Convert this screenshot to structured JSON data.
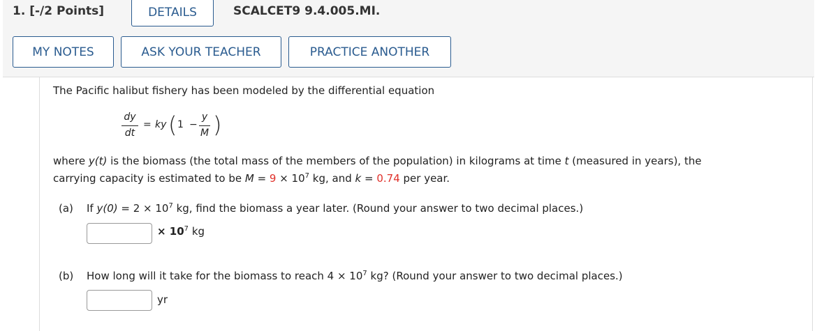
{
  "header": {
    "question_number": "1. [-/2 Points]",
    "details_tab": "DETAILS",
    "question_code": "SCALCET9 9.4.005.MI."
  },
  "toolbar": {
    "my_notes": "MY NOTES",
    "ask_teacher": "ASK YOUR TEACHER",
    "practice_another": "PRACTICE ANOTHER"
  },
  "problem": {
    "intro": "The Pacific halibut fishery has been modeled by the differential equation",
    "equation": {
      "dy": "dy",
      "dt": "dt",
      "equals": "=",
      "ky": "ky",
      "one": "1",
      "minus": "−",
      "y": "y",
      "M": "M"
    },
    "line1_a": "where ",
    "line1_b": "y(t)",
    "line1_c": " is the biomass (the total mass of the members of the population) in kilograms at time ",
    "line1_d": "t",
    "line1_e": " (measured in years), the",
    "line2_a": "carrying capacity is estimated to be ",
    "line2_M": "M",
    "line2_b": " = ",
    "line2_9": "9",
    "line2_c": " × 10",
    "line2_exp": "7",
    "line2_d": " kg, and ",
    "line2_k": "k",
    "line2_e": " = ",
    "line2_kval": "0.74",
    "line2_f": " per year.",
    "accent_color": "#e0302a"
  },
  "part_a": {
    "label": "(a)",
    "text_a": "If ",
    "text_y0": "y(0)",
    "text_b": " = 2 × 10",
    "exp": "7",
    "text_c": " kg, find the biomass a year later. (Round your answer to two decimal places.)",
    "answer_value": "",
    "unit_a": "× 10",
    "unit_exp": "7",
    "unit_b": " kg"
  },
  "part_b": {
    "label": "(b)",
    "text_a": "How long will it take for the biomass to reach 4 × 10",
    "exp": "7",
    "text_b": " kg? (Round your answer to two decimal places.)",
    "answer_value": "",
    "unit": "yr"
  }
}
